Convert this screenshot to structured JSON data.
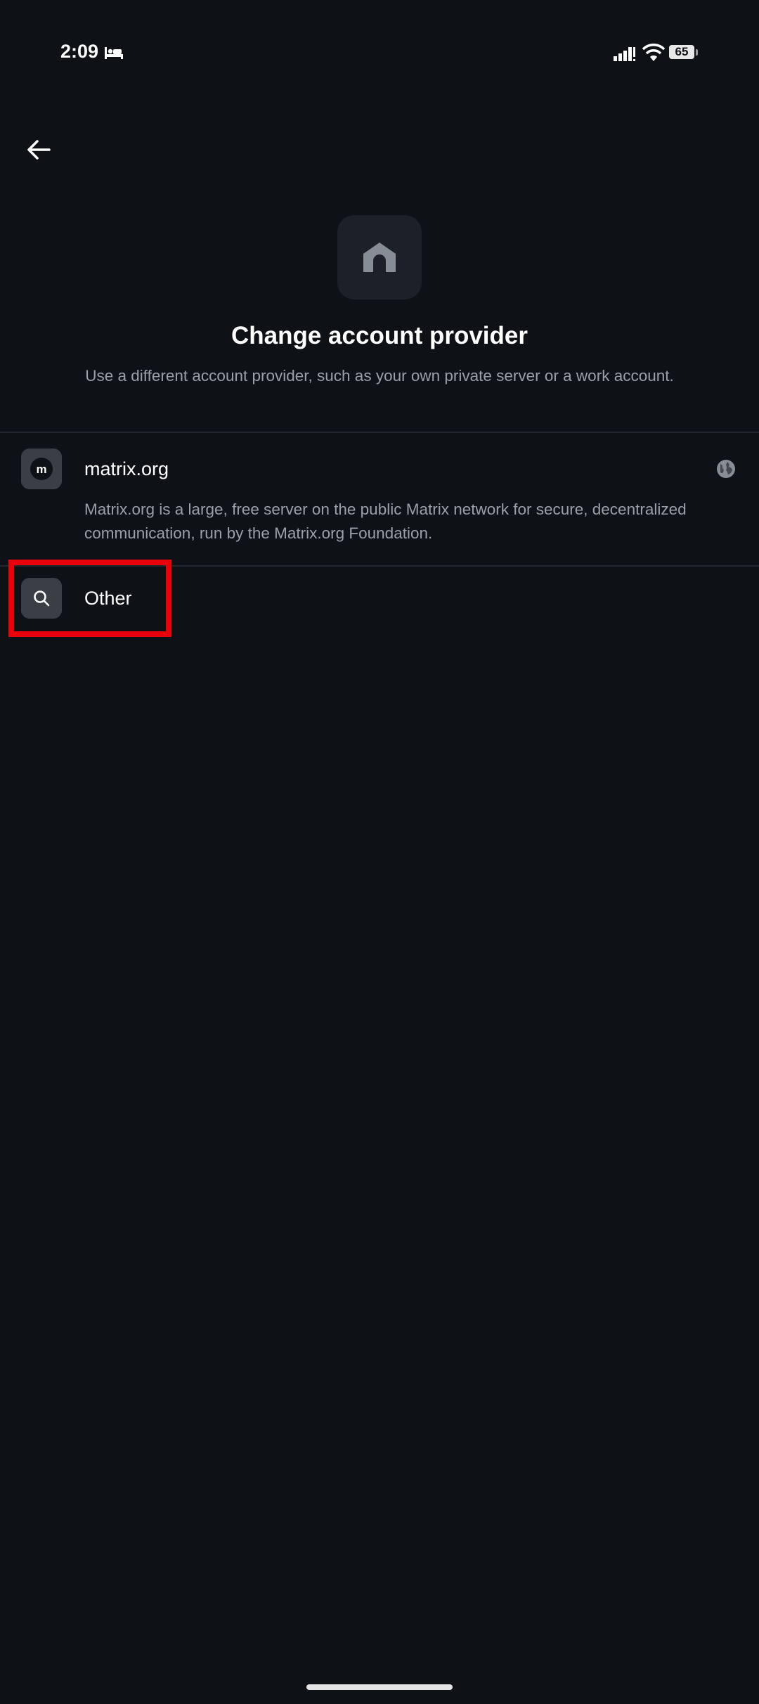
{
  "status_bar": {
    "time": "2:09",
    "battery_level": "65",
    "icons": [
      "sleep-icon",
      "signal-icon",
      "wifi-icon",
      "battery-icon"
    ]
  },
  "nav": {
    "back_icon": "arrow-left-icon"
  },
  "header": {
    "icon": "home-icon",
    "title": "Change account provider",
    "subtitle": "Use a different account provider, such as your own private server or a work account."
  },
  "providers": [
    {
      "name": "matrix.org",
      "icon": "matrix-logo-icon",
      "trailing_icon": "globe-icon",
      "description": "Matrix.org is a large, free server on the public Matrix network for secure, decentralized communication, run by the Matrix.org Foundation."
    },
    {
      "name": "Other",
      "icon": "search-icon"
    }
  ],
  "colors": {
    "background": "#0e1116",
    "secondary_text": "#9ba0a8",
    "highlight": "#e8000b"
  }
}
